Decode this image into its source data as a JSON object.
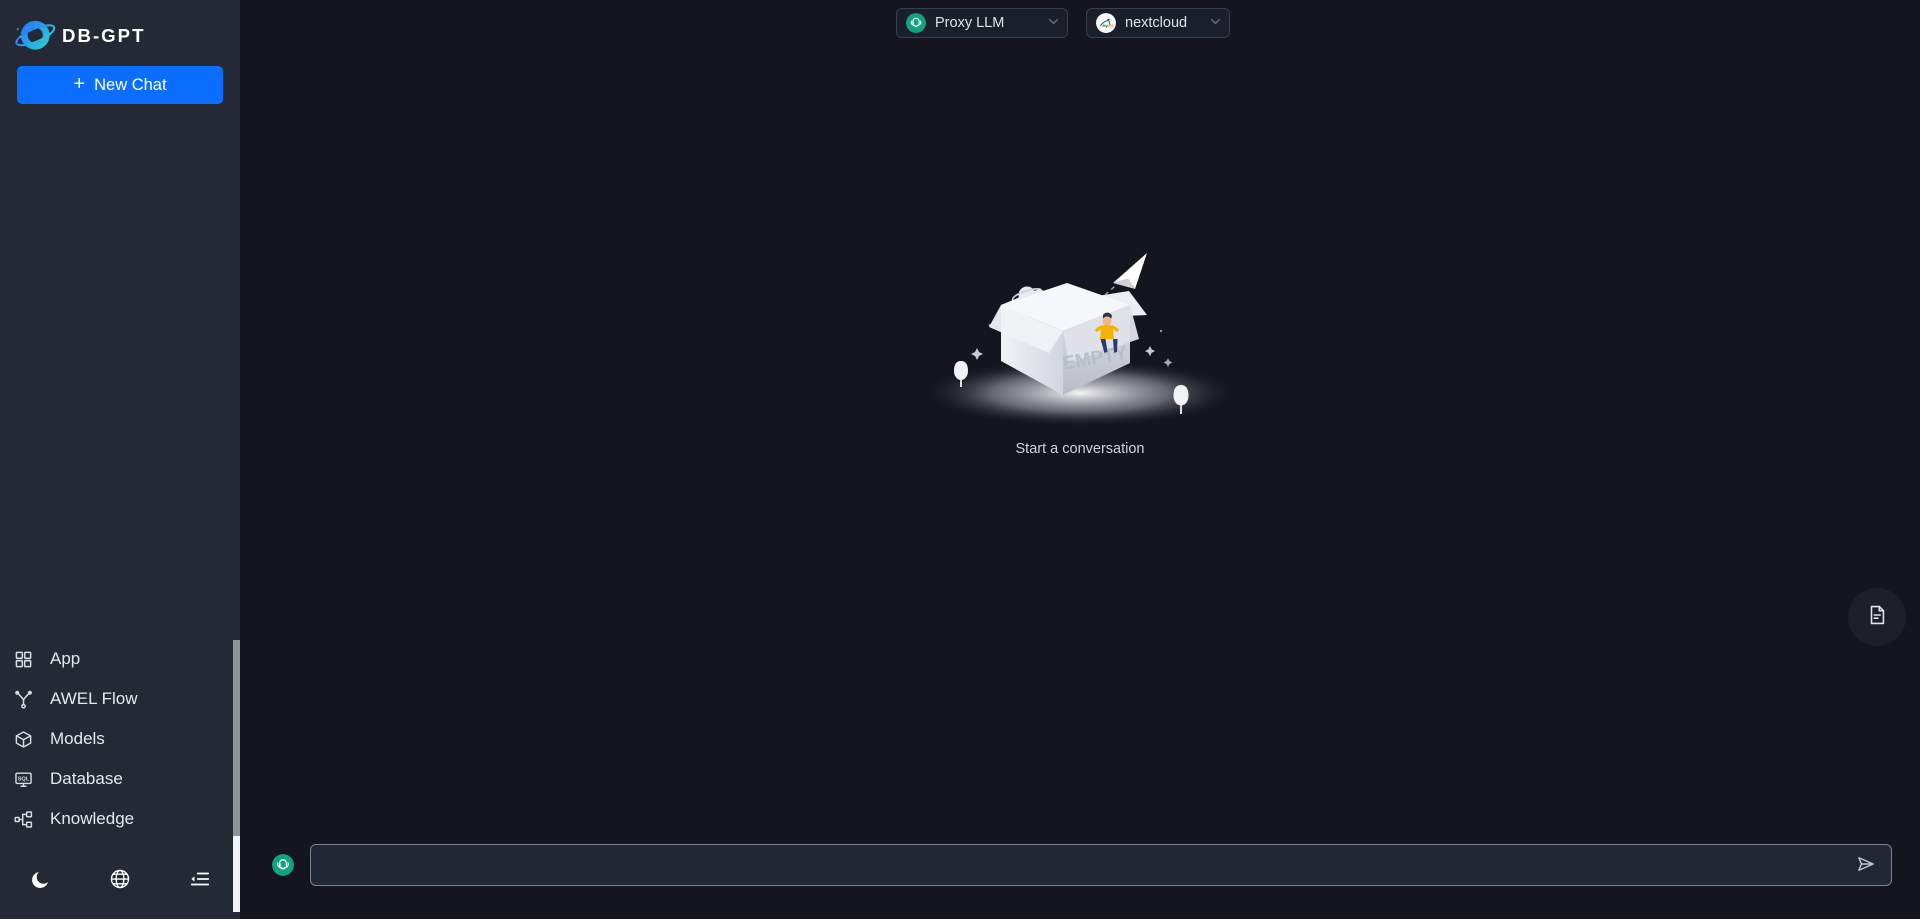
{
  "brand": {
    "name": "DB-GPT"
  },
  "sidebar": {
    "new_chat_label": "New Chat",
    "nav_items": [
      {
        "label": "App",
        "icon": "grid-icon"
      },
      {
        "label": "AWEL Flow",
        "icon": "flow-branch-icon"
      },
      {
        "label": "Models",
        "icon": "cube-icon"
      },
      {
        "label": "Database",
        "icon": "database-sql-icon"
      },
      {
        "label": "Knowledge",
        "icon": "knowledge-graph-icon"
      }
    ],
    "bottom_actions": [
      {
        "name": "dark-mode-toggle",
        "icon": "moon-icon"
      },
      {
        "name": "language-switcher",
        "icon": "globe-icon"
      },
      {
        "name": "collapse-sidebar",
        "icon": "menu-fold-icon"
      }
    ]
  },
  "header": {
    "model_select": {
      "value": "Proxy LLM",
      "icon": "openai-logo-icon"
    },
    "database_select": {
      "value": "nextcloud",
      "icon": "mysql-logo-icon"
    }
  },
  "main": {
    "empty_state": {
      "box_label": "EMPTY",
      "caption": "Start a conversation"
    },
    "doc_button": {
      "icon": "document-icon"
    }
  },
  "chat": {
    "avatar_icon": "openai-logo-icon",
    "input_value": "",
    "input_placeholder": "",
    "send_icon": "send-plane-icon"
  },
  "colors": {
    "accent_blue": "#0c6eff",
    "sidebar_bg": "#252936",
    "main_bg": "#151520",
    "teal": "#10a37f"
  }
}
